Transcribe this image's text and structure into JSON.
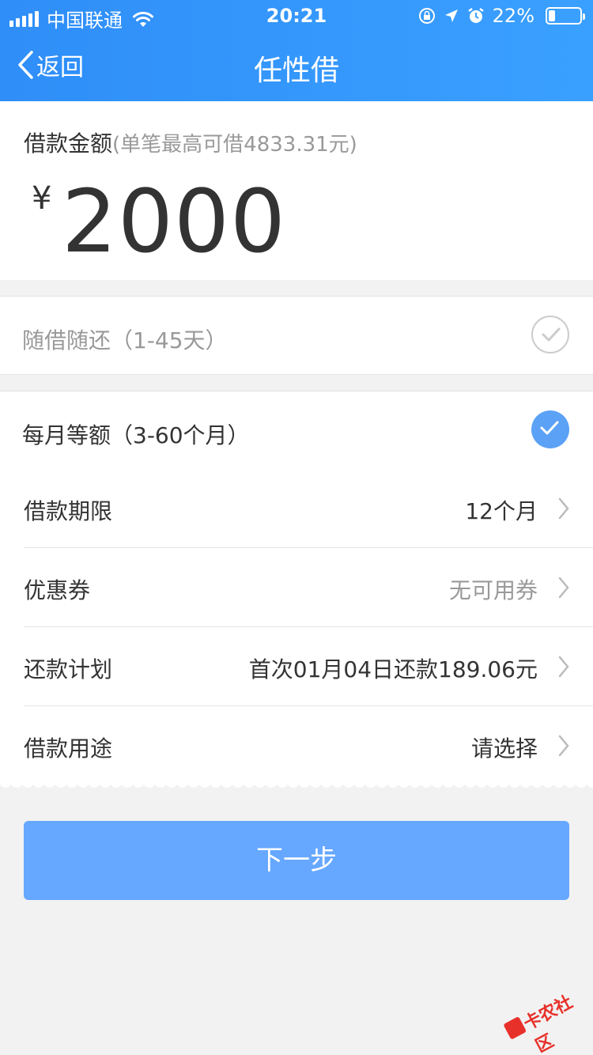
{
  "status_bar": {
    "carrier": "中国联通",
    "time": "20:21",
    "battery": "22%",
    "battery_level": 0.22,
    "icons": [
      "signal-icon",
      "wifi-icon",
      "orientation-lock-icon",
      "location-icon",
      "alarm-icon",
      "battery-icon"
    ]
  },
  "nav": {
    "back_label": "返回",
    "title": "任性借"
  },
  "amount": {
    "label": "借款金额",
    "hint": "(单笔最高可借4833.31元)",
    "currency": "¥",
    "value": "2000"
  },
  "options": {
    "flexible": {
      "label": "随借随还（1-45天）",
      "selected": false
    },
    "monthly": {
      "label": "每月等额（3-60个月）",
      "selected": true
    }
  },
  "rows": [
    {
      "label": "借款期限",
      "value": "12个月",
      "muted": false
    },
    {
      "label": "优惠券",
      "value": "无可用券",
      "muted": true
    },
    {
      "label": "还款计划",
      "value": "首次01月04日还款189.06元",
      "muted": false
    },
    {
      "label": "借款用途",
      "value": "请选择",
      "muted": false
    }
  ],
  "next_button": {
    "label": "下一步"
  },
  "watermark": {
    "text": "卡农社区"
  },
  "colors": {
    "header": "#3aa0ff",
    "accent": "#5ba1f6",
    "button": "#66a7ff",
    "watermark": "#e8302a"
  }
}
